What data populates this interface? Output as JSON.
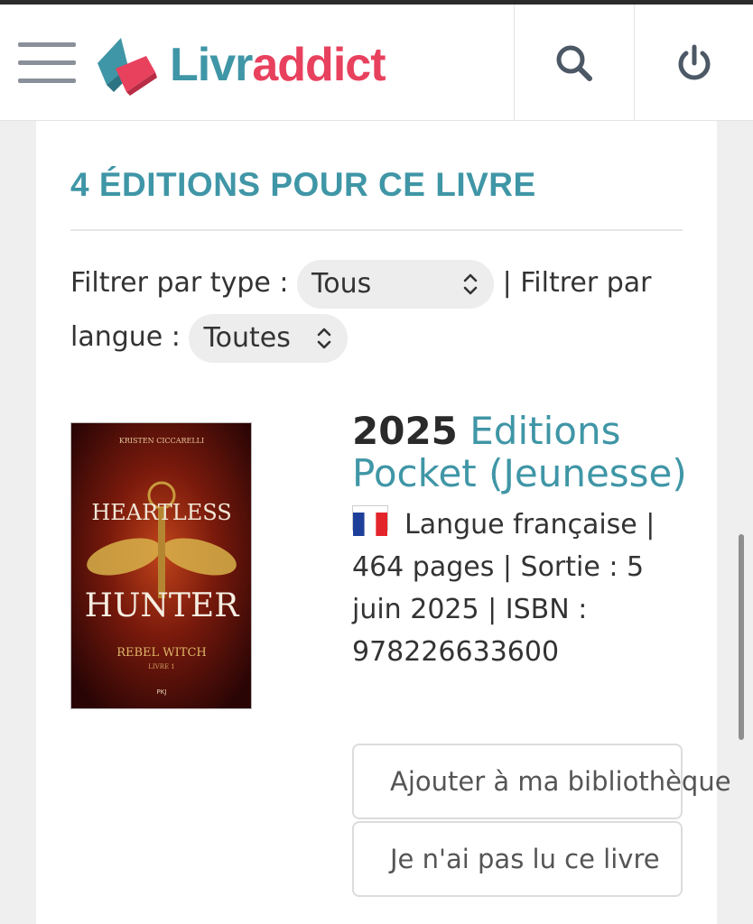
{
  "header": {
    "logo_part1": "Livr",
    "logo_part2": "addict"
  },
  "section": {
    "title": "4 ÉDITIONS POUR CE LIVRE"
  },
  "filters": {
    "type_label": "Filtrer par type :",
    "type_value": "Tous",
    "separator": "| Filtrer par",
    "lang_label": "langue :",
    "lang_value": "Toutes"
  },
  "edition": {
    "year": "2025",
    "publisher": "Editions Pocket (Jeunesse)",
    "language": "Langue française |",
    "details": "464 pages | Sortie : 5 juin 2025 | ISBN : 978226633600",
    "cover": {
      "author": "KRISTEN CICCARELLI",
      "title1": "HEARTLESS",
      "title2": "HUNTER",
      "subtitle": "REBEL WITCH",
      "tome": "LIVRE 1",
      "imprint": "PKJ"
    }
  },
  "actions": {
    "add_label": "Ajouter à ma bibliothèque",
    "unread_label": "Je n'ai pas lu ce livre"
  },
  "icons": {
    "menu": "hamburger-icon",
    "search": "search-icon",
    "power": "power-icon",
    "flag": "france-flag-icon"
  },
  "colors": {
    "accent": "#3f96a6",
    "brand_pink": "#e8415e"
  }
}
